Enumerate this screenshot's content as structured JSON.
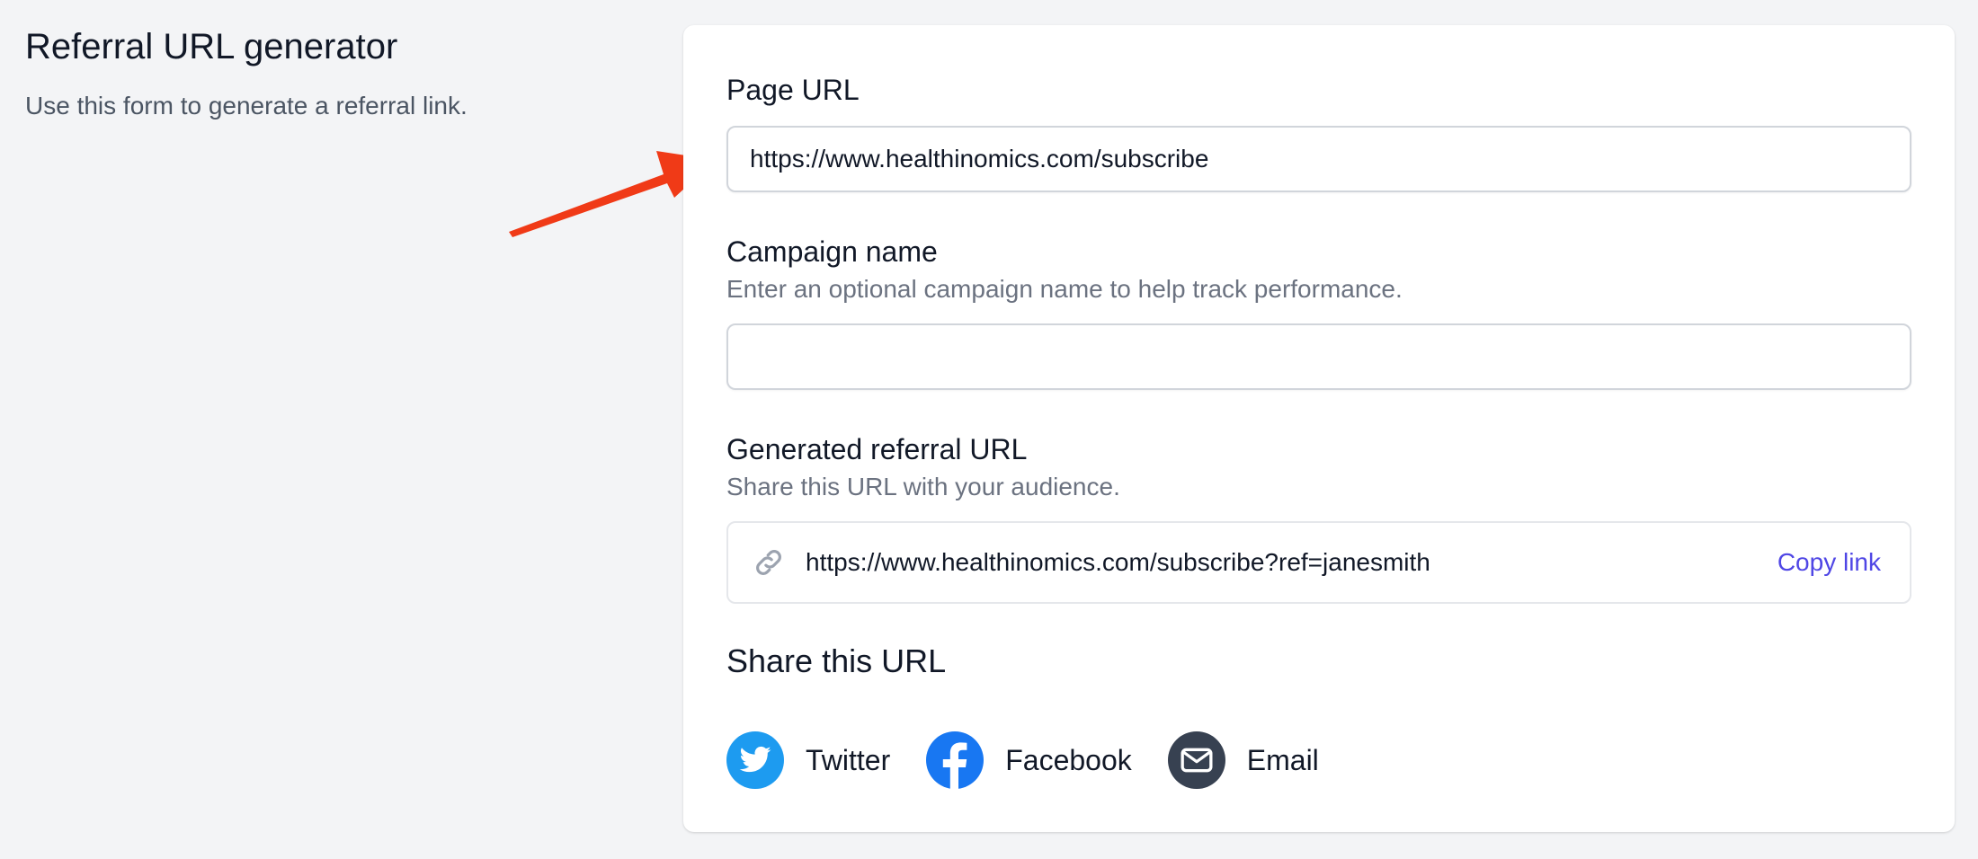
{
  "intro": {
    "title": "Referral URL generator",
    "description": "Use this form to generate a referral link."
  },
  "form": {
    "page_url": {
      "label": "Page URL",
      "value": "https://www.healthinomics.com/subscribe"
    },
    "campaign_name": {
      "label": "Campaign name",
      "help": "Enter an optional campaign name to help track performance.",
      "value": ""
    },
    "generated_url": {
      "label": "Generated referral URL",
      "help": "Share this URL with your audience.",
      "value": "https://www.healthinomics.com/subscribe?ref=janesmith",
      "copy_label": "Copy link",
      "icon": "link-icon"
    }
  },
  "share": {
    "title": "Share this URL",
    "items": [
      {
        "label": "Twitter",
        "icon": "twitter-icon",
        "color": "#1d9bf0"
      },
      {
        "label": "Facebook",
        "icon": "facebook-icon",
        "color": "#1877f2"
      },
      {
        "label": "Email",
        "icon": "envelope-icon",
        "color": "#374151"
      }
    ]
  },
  "annotation": {
    "arrow_color": "#f03a17"
  },
  "colors": {
    "accent": "#4f46e5",
    "background": "#f3f4f6"
  }
}
